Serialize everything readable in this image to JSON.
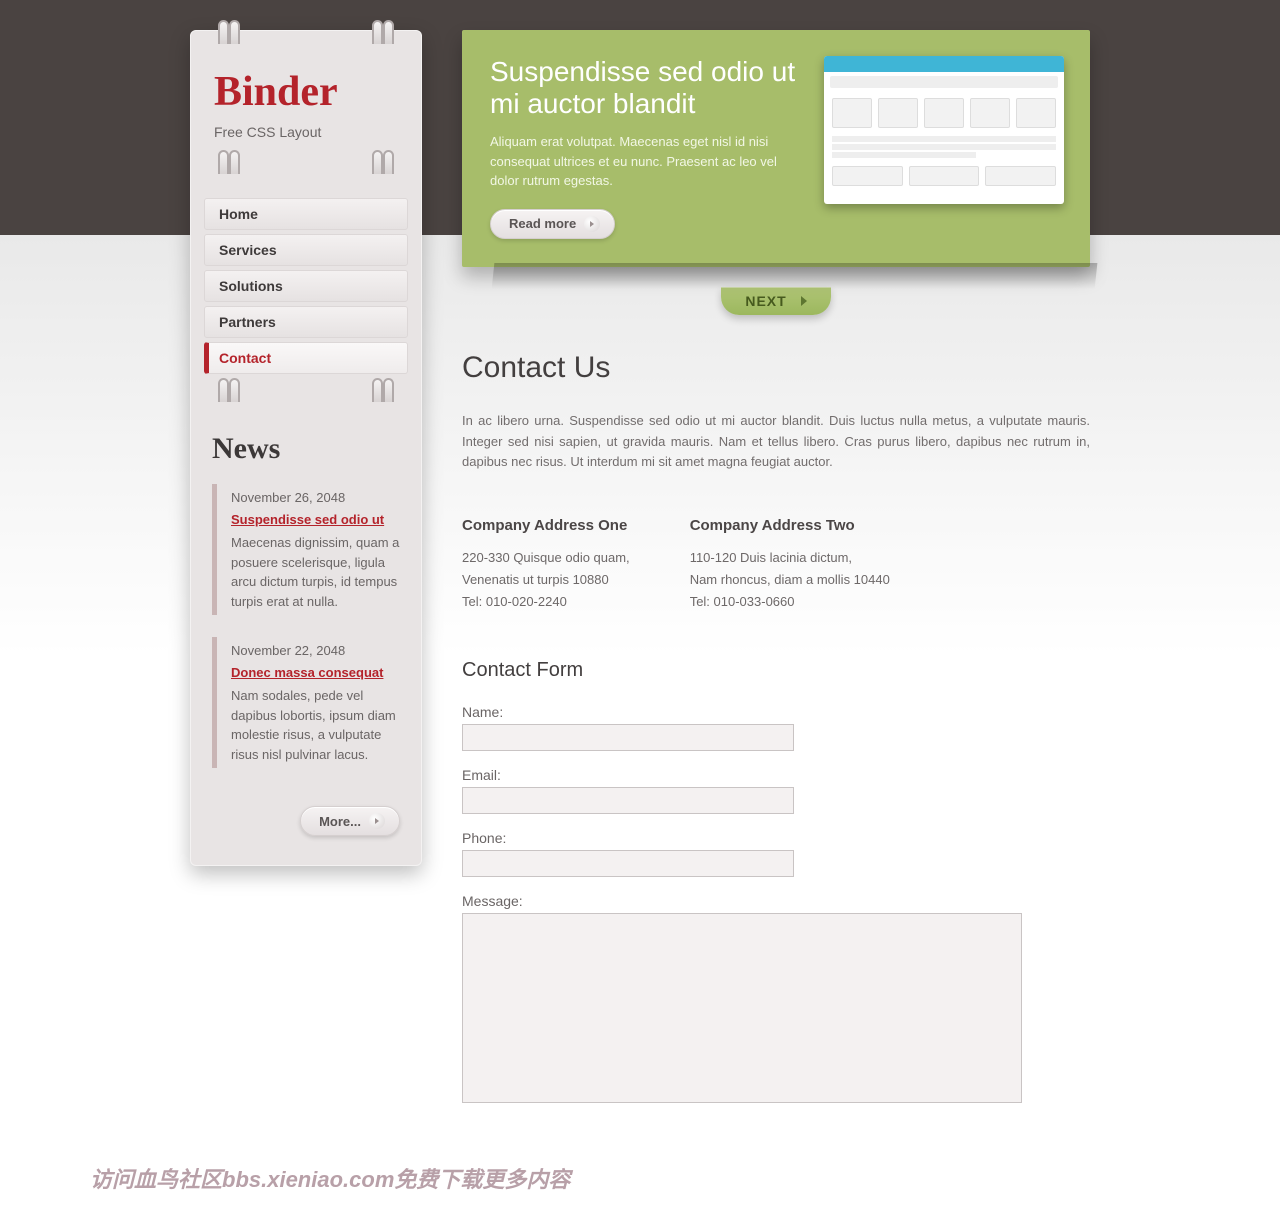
{
  "brand": {
    "name": "Binder",
    "tagline": "Free CSS Layout"
  },
  "nav": {
    "items": [
      {
        "label": "Home",
        "active": false
      },
      {
        "label": "Services",
        "active": false
      },
      {
        "label": "Solutions",
        "active": false
      },
      {
        "label": "Partners",
        "active": false
      },
      {
        "label": "Contact",
        "active": true
      }
    ]
  },
  "news": {
    "heading": "News",
    "items": [
      {
        "date": "November 26, 2048",
        "title": "Suspendisse sed odio ut",
        "body": "Maecenas dignissim, quam a posuere scelerisque, ligula arcu dictum turpis, id tempus turpis erat at nulla."
      },
      {
        "date": "November 22, 2048",
        "title": "Donec massa consequat",
        "body": "Nam sodales, pede vel dapibus lobortis, ipsum diam molestie risus, a vulputate risus nisl pulvinar lacus."
      }
    ],
    "more_label": "More..."
  },
  "hero": {
    "title": "Suspendisse sed odio ut mi auctor blandit",
    "body": "Aliquam erat volutpat. Maecenas eget nisl id nisi consequat ultrices et eu nunc. Praesent ac leo vel dolor rutrum egestas.",
    "read_label": "Read more",
    "next_label": "NEXT"
  },
  "page": {
    "title": "Contact Us",
    "intro": "In ac libero urna. Suspendisse sed odio ut mi auctor blandit. Duis luctus nulla metus, a vulputate mauris. Integer sed nisi sapien, ut gravida mauris. Nam et tellus libero. Cras purus libero, dapibus nec rutrum in, dapibus nec risus. Ut interdum mi sit amet magna feugiat auctor."
  },
  "addresses": [
    {
      "heading": "Company Address One",
      "line1": "220-330 Quisque odio quam,",
      "line2": "Venenatis ut turpis 10880",
      "line3": "Tel: 010-020-2240"
    },
    {
      "heading": "Company Address Two",
      "line1": "110-120 Duis lacinia dictum,",
      "line2": "Nam rhoncus, diam a mollis 10440",
      "line3": "Tel: 010-033-0660"
    }
  ],
  "form": {
    "heading": "Contact Form",
    "fields": {
      "name": "Name:",
      "email": "Email:",
      "phone": "Phone:",
      "message": "Message:"
    }
  },
  "footer_note": "访问血鸟社区bbs.xieniao.com免费下载更多内容"
}
